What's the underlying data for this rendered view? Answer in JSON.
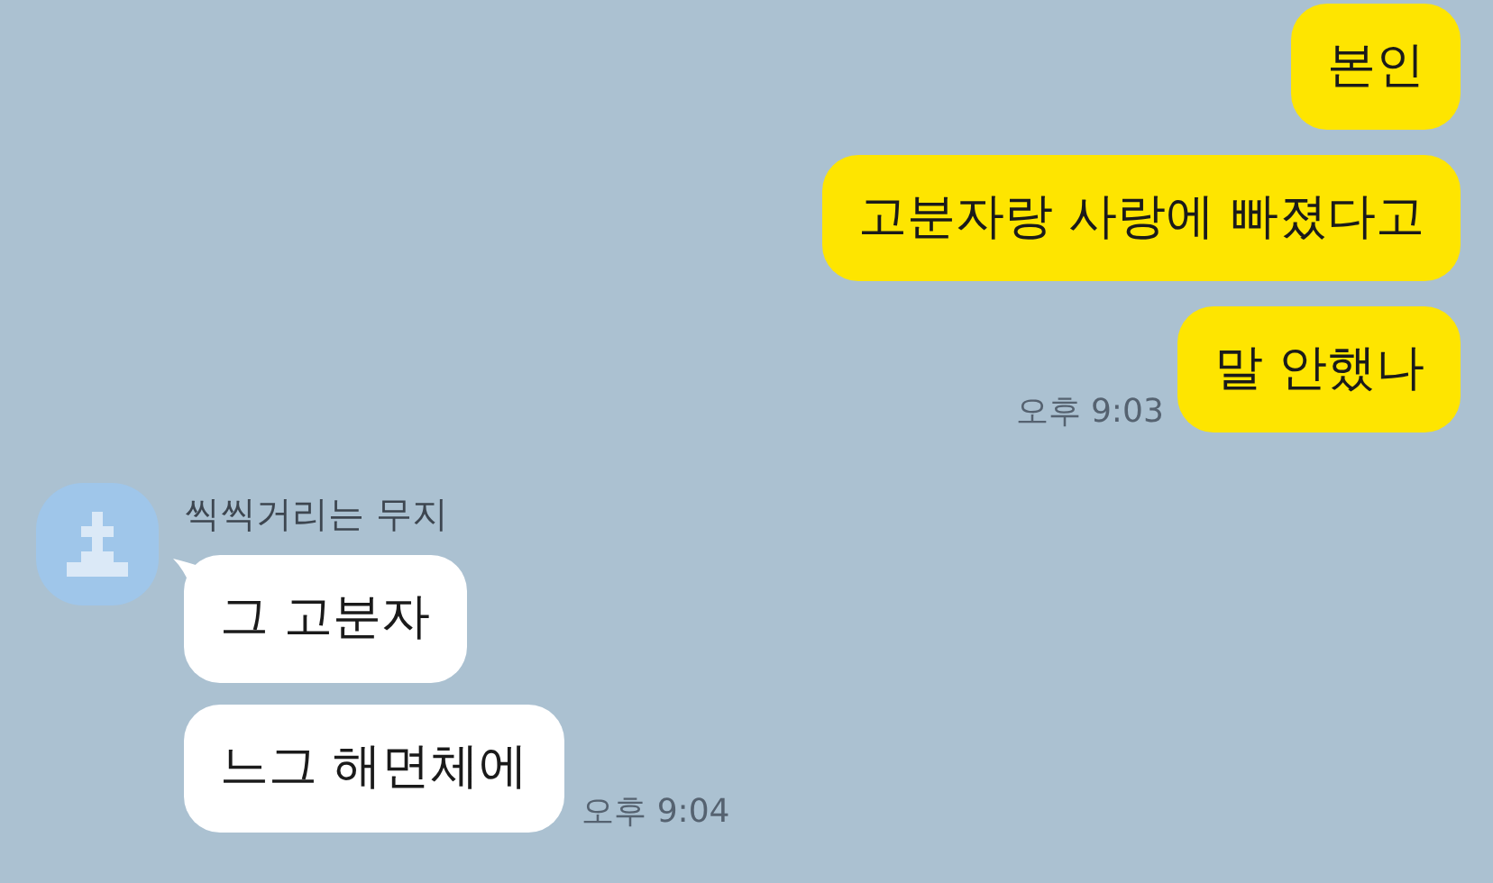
{
  "sent": {
    "messages": [
      "본인",
      "고분자랑 사랑에 빠졌다고",
      "말 안했나"
    ],
    "time": "오후 9:03"
  },
  "received": {
    "sender": "씩씩거리는 무지",
    "messages": [
      "그 고분자",
      "느그 해면체에"
    ],
    "time": "오후 9:04"
  }
}
